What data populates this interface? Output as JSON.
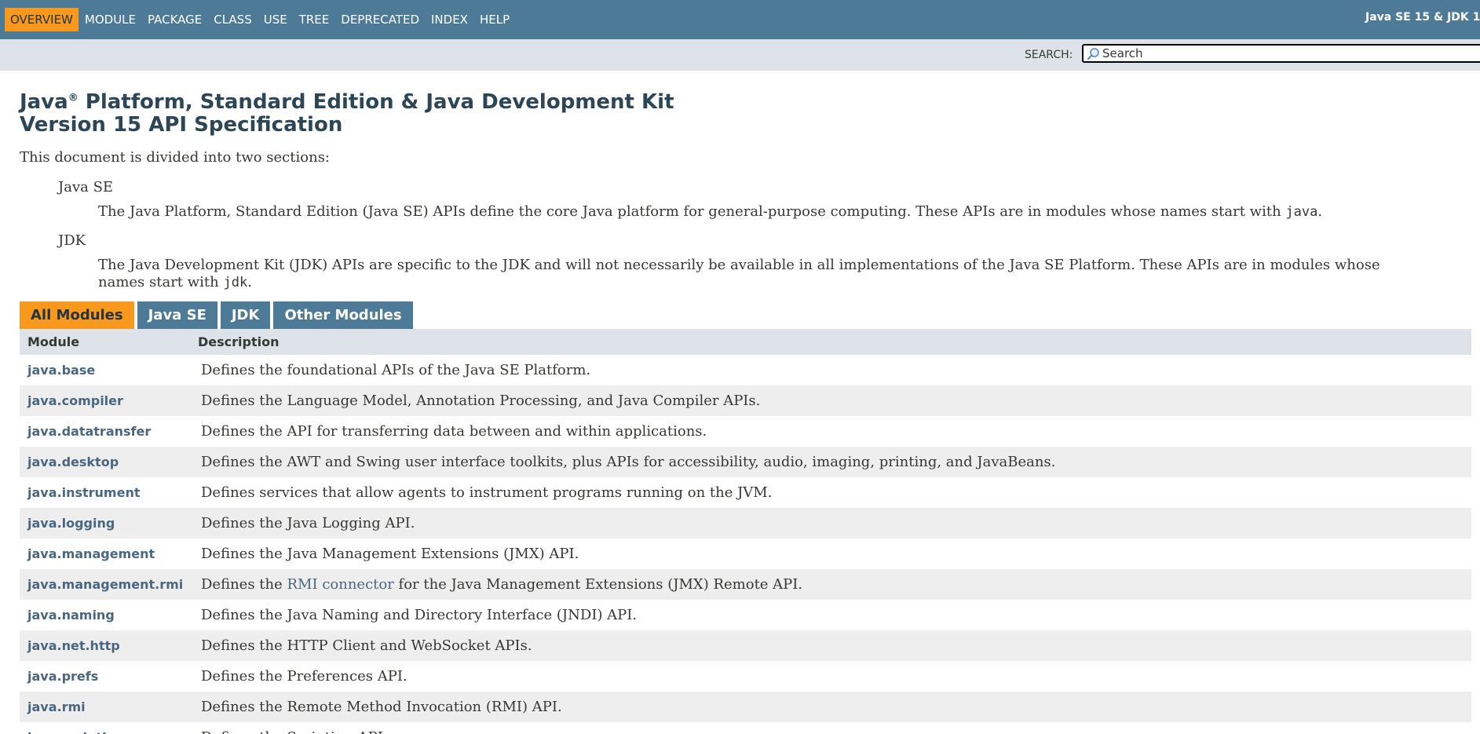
{
  "nav": {
    "items": [
      "OVERVIEW",
      "MODULE",
      "PACKAGE",
      "CLASS",
      "USE",
      "TREE",
      "DEPRECATED",
      "INDEX",
      "HELP"
    ],
    "active_index": 0,
    "about": "Java SE 15 & JDK 1"
  },
  "search": {
    "label": "SEARCH:",
    "placeholder": "Search",
    "icon": "magnifier-icon"
  },
  "header": {
    "title_part1": "Java",
    "title_reg": "®",
    "title_part2": " Platform, Standard Edition & Java Development Kit",
    "title_line2": "Version 15 API Specification"
  },
  "intro": "This document is divided into two sections:",
  "sections": [
    {
      "term": "Java SE",
      "desc_before": "The Java Platform, Standard Edition (Java SE) APIs define the core Java platform for general-purpose computing. These APIs are in modules whose names start with ",
      "code": "java",
      "desc_after": "."
    },
    {
      "term": "JDK",
      "desc_before": "The Java Development Kit (JDK) APIs are specific to the JDK and will not necessarily be available in all implementations of the Java SE Platform. These APIs are in modules whose names start with ",
      "code": "jdk",
      "desc_after": "."
    }
  ],
  "tabs": [
    "All Modules",
    "Java SE",
    "JDK",
    "Other Modules"
  ],
  "active_tab": 0,
  "table": {
    "headers": [
      "Module",
      "Description"
    ],
    "rows": [
      {
        "module": "java.base",
        "description": "Defines the foundational APIs of the Java SE Platform."
      },
      {
        "module": "java.compiler",
        "description": "Defines the Language Model, Annotation Processing, and Java Compiler APIs."
      },
      {
        "module": "java.datatransfer",
        "description": "Defines the API for transferring data between and within applications."
      },
      {
        "module": "java.desktop",
        "description": "Defines the AWT and Swing user interface toolkits, plus APIs for accessibility, audio, imaging, printing, and JavaBeans."
      },
      {
        "module": "java.instrument",
        "description": "Defines services that allow agents to instrument programs running on the JVM."
      },
      {
        "module": "java.logging",
        "description": "Defines the Java Logging API."
      },
      {
        "module": "java.management",
        "description": "Defines the Java Management Extensions (JMX) API."
      },
      {
        "module": "java.management.rmi",
        "description_before": "Defines the ",
        "link": "RMI connector",
        "description_after": " for the Java Management Extensions (JMX) Remote API."
      },
      {
        "module": "java.naming",
        "description": "Defines the Java Naming and Directory Interface (JNDI) API."
      },
      {
        "module": "java.net.http",
        "description": "Defines the HTTP Client and WebSocket APIs."
      },
      {
        "module": "java.prefs",
        "description": "Defines the Preferences API."
      },
      {
        "module": "java.rmi",
        "description": "Defines the Remote Method Invocation (RMI) API."
      },
      {
        "module": "java.scripting",
        "description": "Defines the Scripting API."
      }
    ]
  },
  "colors": {
    "nav_bg": "#4d7a97",
    "active_orange": "#f8981d",
    "subnav_bg": "#dee3e9",
    "link": "#4a6782",
    "title": "#2c4557",
    "alt_row": "#eeeeef"
  }
}
